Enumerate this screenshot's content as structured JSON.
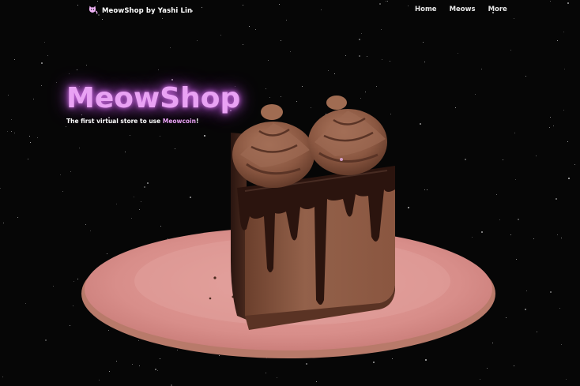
{
  "nav": {
    "brand_label": "MeowShop by Yashi Lin",
    "links": [
      "Home",
      "Meows",
      "More"
    ]
  },
  "hero": {
    "title": "MeowShop",
    "subtitle_prefix": "The first virtual store to use ",
    "subtitle_link": "Meowcoin",
    "subtitle_suffix": "!"
  },
  "colors": {
    "background": "#060606",
    "accent_glow": "#e9a2f4",
    "plate": "#d88f8c",
    "cake": "#8b5a44",
    "ganache": "#2a1410"
  },
  "icons": {
    "brand_icon": "cat-icon"
  }
}
